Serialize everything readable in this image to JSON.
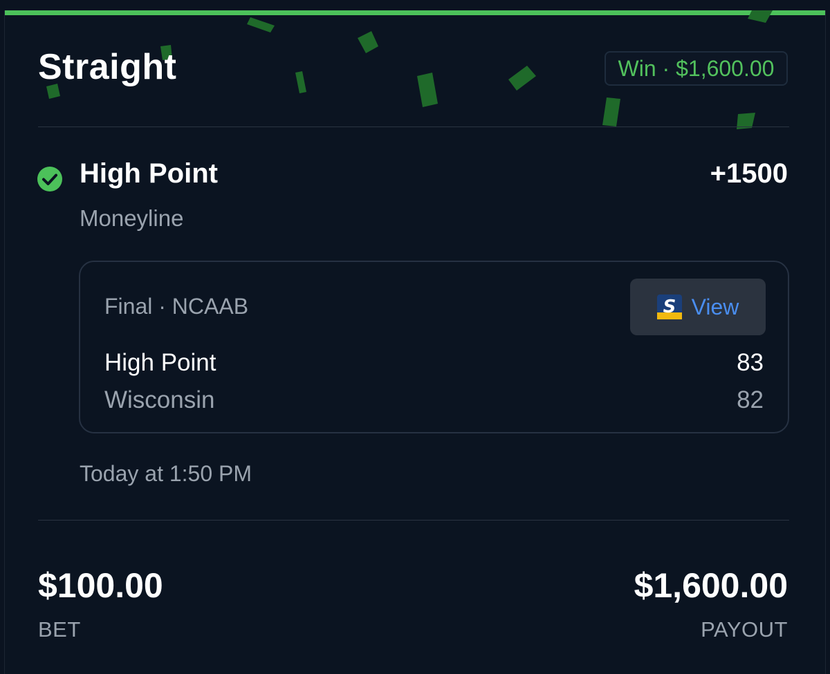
{
  "header": {
    "title": "Straight",
    "status": "Win · $1,600.00",
    "accent_color": "#52c15d"
  },
  "pick": {
    "icon": "check-circle-icon",
    "team": "High Point",
    "odds": "+1500",
    "market": "Moneyline"
  },
  "game": {
    "status": "Final · NCAAB",
    "view_label": "View",
    "view_icon": "scores-app-logo-icon",
    "teams": [
      {
        "name": "High Point",
        "score": "83"
      },
      {
        "name": "Wisconsin",
        "score": "82"
      }
    ]
  },
  "timestamp": "Today at 1:50 PM",
  "footer": {
    "bet_amount": "$100.00",
    "bet_label": "BET",
    "payout_amount": "$1,600.00",
    "payout_label": "PAYOUT"
  }
}
